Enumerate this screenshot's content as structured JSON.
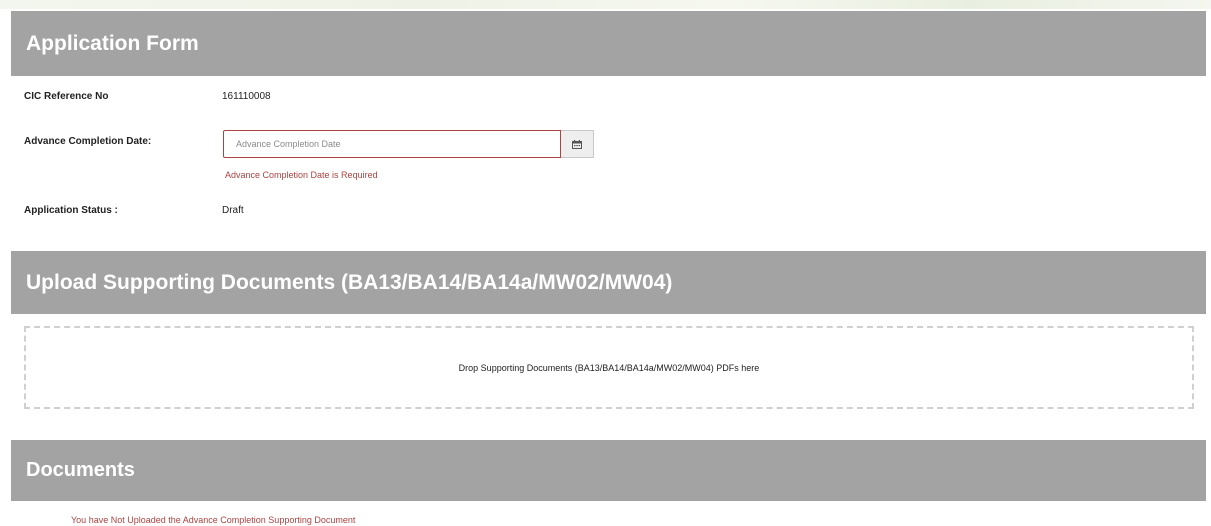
{
  "application_form": {
    "title": "Application Form",
    "cic_reference_label": "CIC Reference No",
    "cic_reference_value": "161110008",
    "advance_completion_label": "Advance Completion Date:",
    "advance_completion_placeholder": "Advance Completion Date",
    "advance_completion_value": "",
    "advance_completion_error": "Advance Completion Date is Required",
    "calendar_icon": "calendar-icon",
    "status_label": "Application Status :",
    "status_value": "Draft"
  },
  "upload": {
    "title": "Upload Supporting Documents (BA13/BA14/BA14a/MW02/MW04)",
    "dropzone_text": "Drop Supporting Documents (BA13/BA14/BA14a/MW02/MW04) PDFs here"
  },
  "documents": {
    "title": "Documents",
    "warning": "You have Not Uploaded the Advance Completion Supporting Document"
  },
  "colors": {
    "header_bg": "#a3a3a3",
    "error": "#a94442"
  }
}
